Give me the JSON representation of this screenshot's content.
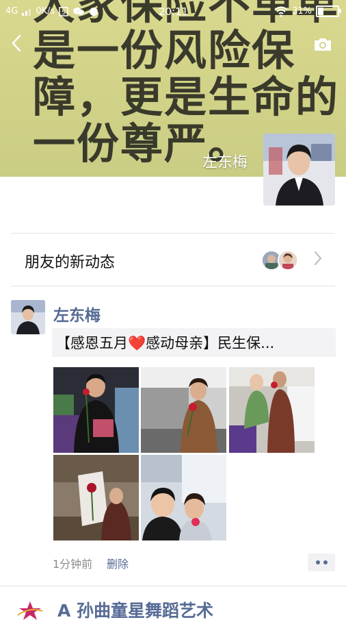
{
  "status_bar": {
    "network": "4G",
    "speed": "0K/s",
    "time": "20:11",
    "battery": "31%",
    "battery_level": 0.31
  },
  "cover": {
    "lines": [
      "是一份风险保",
      "障，更是生命的",
      "一份尊严。"
    ],
    "top_partial": "大家保险不单单",
    "profile_name": "左东梅",
    "background_color": "#d5d58b"
  },
  "friends_updates": {
    "label": "朋友的新动态"
  },
  "post": {
    "author": "左东梅",
    "share_text_before": "【感恩五月",
    "share_emoji": "❤️",
    "share_text_after": "感动母亲】民生保...",
    "time": "1分钟前",
    "delete_label": "删除",
    "photos": [
      "man-holding-rose-photo",
      "woman-on-sofa-with-rose-photo",
      "woman-holding-child-photo",
      "woman-with-rose-bag-photo",
      "two-women-selfie-photo"
    ]
  },
  "next_post": {
    "author": "A 孙曲童星舞蹈艺术"
  },
  "colors": {
    "link_blue": "#576b95",
    "meta_gray": "#8a8a8a",
    "heart_red": "#e0202a"
  }
}
